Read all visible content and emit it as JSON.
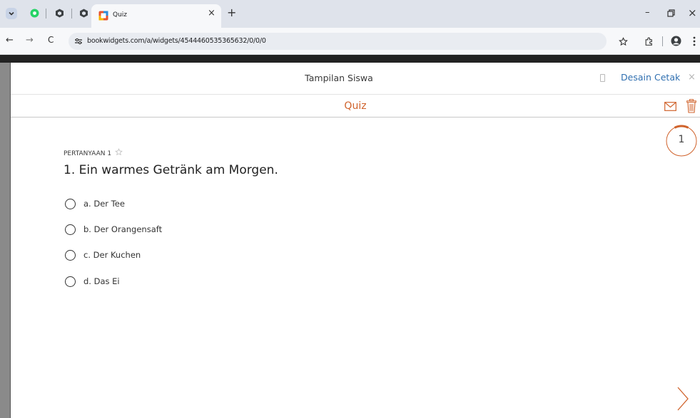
{
  "browser": {
    "tab_title": "Quiz",
    "tab_close": "×",
    "new_tab": "+",
    "url": "bookwidgets.com/a/widgets/4544460535365632/0/0/0",
    "back": "←",
    "forward": "→",
    "reload": "C",
    "minimize": "–",
    "close": "×"
  },
  "header": {
    "title": "Tampilan Siswa",
    "design_label": "Desain",
    "print_label": "Cetak",
    "close_label": "×"
  },
  "quiz": {
    "title": "Quiz",
    "progress_number": "1",
    "progress_fraction": 0.15,
    "accent_color": "#d0632c"
  },
  "question": {
    "label": "PERTANYAAN 1",
    "text": "1. Ein warmes Getränk am Morgen.",
    "options": [
      "a. Der Tee",
      "b. Der Orangensaft",
      "c. Der Kuchen",
      "d. Das Ei"
    ]
  }
}
